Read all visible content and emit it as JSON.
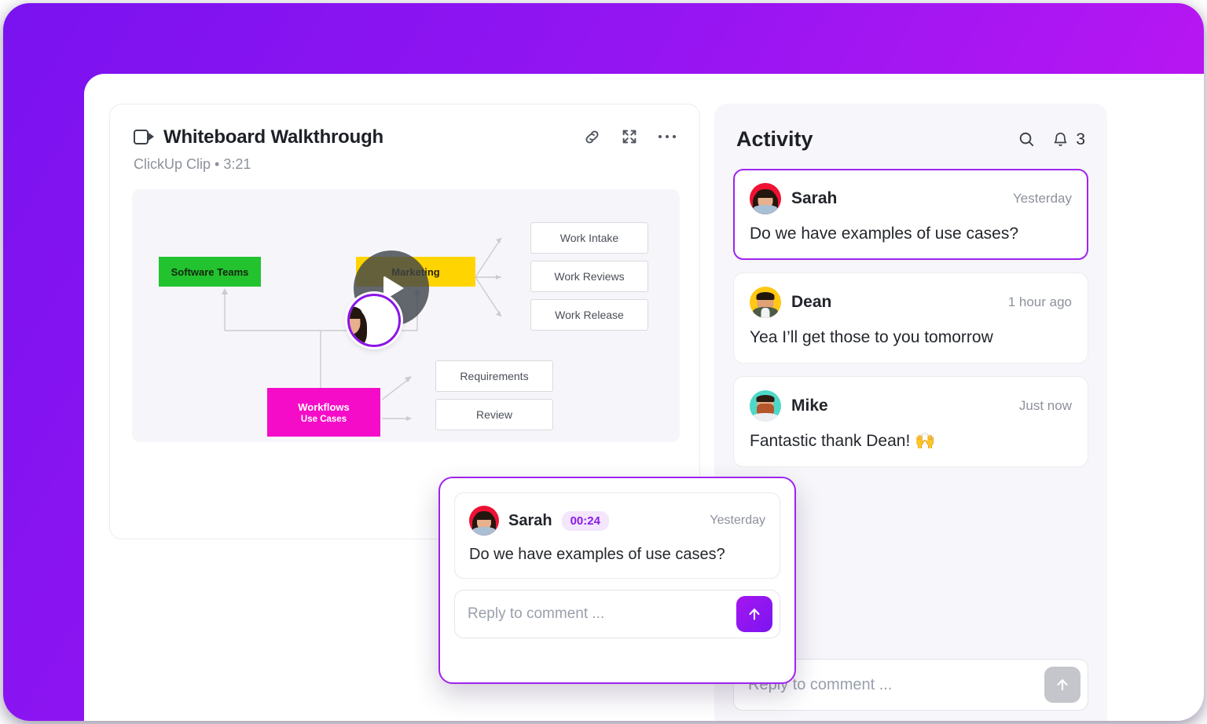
{
  "theme": {
    "brand_purple": "#a023ee",
    "gradient_from": "#7a12f0",
    "gradient_to": "#d117ef",
    "accent_badge_bg": "#f3e6fd",
    "panel_bg": "#f7f6fa"
  },
  "clip": {
    "icon": "video-camera-icon",
    "title": "Whiteboard Walkthrough",
    "subtitle": "ClickUp Clip • 3:21",
    "source": "ClickUp Clip",
    "duration": "3:21",
    "actions": [
      {
        "name": "copy-link-button",
        "icon": "link-icon"
      },
      {
        "name": "fullscreen-button",
        "icon": "expand-icon"
      },
      {
        "name": "more-options-button",
        "icon": "ellipsis-icon"
      }
    ],
    "play_button_label": "play-icon"
  },
  "whiteboard": {
    "nodes": [
      {
        "id": "software-teams",
        "label": "Software Teams",
        "sublabel": "",
        "color": "green"
      },
      {
        "id": "marketing",
        "label": "Marketing",
        "sublabel": "",
        "color": "yellow"
      },
      {
        "id": "workflows",
        "label": "Workflows",
        "sublabel": "Use Cases",
        "color": "magenta"
      },
      {
        "id": "work-intake",
        "label": "Work Intake",
        "sublabel": "",
        "color": "white"
      },
      {
        "id": "work-reviews",
        "label": "Work Reviews",
        "sublabel": "",
        "color": "white"
      },
      {
        "id": "work-release",
        "label": "Work Release",
        "sublabel": "",
        "color": "white"
      },
      {
        "id": "requirements",
        "label": "Requirements",
        "sublabel": "",
        "color": "white"
      },
      {
        "id": "review",
        "label": "Review",
        "sublabel": "",
        "color": "white"
      }
    ]
  },
  "popup": {
    "comment": {
      "author": "Sarah",
      "timestamp_badge": "00:24",
      "time": "Yesterday",
      "text": "Do we have examples of use cases?"
    },
    "reply_placeholder": "Reply to comment ...",
    "reply_value": "",
    "send_label": "send-icon"
  },
  "activity": {
    "title": "Activity",
    "search_icon": "search-icon",
    "bell_icon": "bell-icon",
    "notification_count": "3",
    "comments": [
      {
        "author": "Sarah",
        "time": "Yesterday",
        "text": "Do we have examples of use cases?",
        "selected": true,
        "avatar": "sarah"
      },
      {
        "author": "Dean",
        "time": "1 hour ago",
        "text": "Yea I’ll get those to you tomorrow",
        "selected": false,
        "avatar": "dean"
      },
      {
        "author": "Mike",
        "time": "Just now",
        "text": "Fantastic thank Dean! 🙌",
        "selected": false,
        "avatar": "mike"
      }
    ],
    "reply_placeholder": "Reply to comment ...",
    "reply_value": "",
    "send_label": "send-icon"
  }
}
